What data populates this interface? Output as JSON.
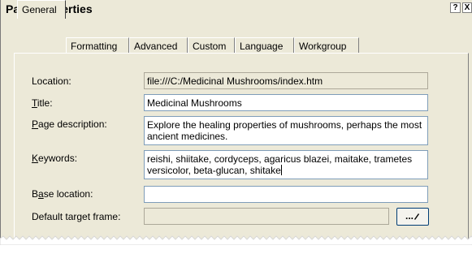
{
  "window": {
    "title": "Page Properties",
    "help_glyph": "?",
    "close_glyph": "X"
  },
  "tabs": [
    {
      "label": "General",
      "active": true
    },
    {
      "label": "Formatting"
    },
    {
      "label": "Advanced"
    },
    {
      "label": "Custom"
    },
    {
      "label": "Language"
    },
    {
      "label": "Workgroup"
    }
  ],
  "fields": {
    "location": {
      "label": "Location:",
      "value": "file:///C:/Medicinal Mushrooms/index.htm"
    },
    "title": {
      "label_key": "T",
      "label_rest": "itle:",
      "value": "Medicinal Mushrooms"
    },
    "description": {
      "label_key": "P",
      "label_rest": "age description:",
      "value": "Explore the healing properties of mushrooms, perhaps the most ancient medicines."
    },
    "keywords": {
      "label_key": "K",
      "label_rest": "eywords:",
      "value": "reishi, shiitake, cordyceps, agaricus blazei, maitake, trametes versicolor, beta-glucan, shitake"
    },
    "base_location": {
      "label_pre": "B",
      "label_key": "a",
      "label_rest": "se location:",
      "value": ""
    },
    "target_frame": {
      "label_pre": "Default tar",
      "label_key": "g",
      "label_rest": "et frame:",
      "value": ""
    }
  },
  "browse_button": {
    "label": "...",
    "icon": "pencil-icon"
  },
  "colors": {
    "dialog_bg": "#ece9d8",
    "field_border": "#7f9db9"
  }
}
